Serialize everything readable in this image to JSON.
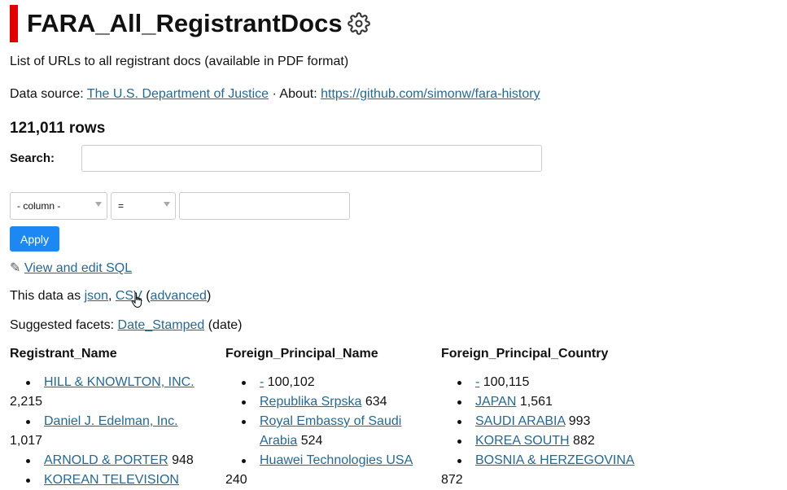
{
  "page": {
    "title": "FARA_All_RegistrantDocs",
    "description": "List of URLs to all registrant docs (available in PDF format)",
    "source_prefix": "Data source: ",
    "source_link": "The U.S. Department of Justice",
    "about_prefix": " · About: ",
    "about_link": "https://github.com/simonw/fara-history",
    "rows_count": "121,011 rows"
  },
  "search": {
    "label": "Search:",
    "value": ""
  },
  "filter": {
    "column_select": "- column -",
    "operator_select": "=",
    "value": "",
    "apply_label": "Apply"
  },
  "sql_link": {
    "icon": "✎",
    "label": "View and edit SQL"
  },
  "export": {
    "prefix": "This data as ",
    "json": "json",
    "sep": ", ",
    "csv": "CSV",
    "open_paren": " (",
    "advanced": "advanced",
    "close_paren": ")"
  },
  "suggested_facets": {
    "prefix": "Suggested facets: ",
    "link": "Date_Stamped",
    "suffix": " (date)"
  },
  "facets": [
    {
      "title": "Registrant_Name",
      "items": [
        {
          "label": "HILL & KNOWLTON, INC.",
          "count": "2,215"
        },
        {
          "label": "Daniel J. Edelman, Inc.",
          "count": "1,017"
        },
        {
          "label": "ARNOLD & PORTER",
          "count": "948"
        },
        {
          "label": "KOREAN TELEVISION",
          "count": ""
        }
      ]
    },
    {
      "title": "Foreign_Principal_Name",
      "items": [
        {
          "label": "-",
          "count": "100,102"
        },
        {
          "label": "Republika Srpska",
          "count": "634"
        },
        {
          "label": "Royal Embassy of Saudi Arabia",
          "count": "524"
        },
        {
          "label": "Huawei Technologies USA",
          "count": "240"
        }
      ]
    },
    {
      "title": "Foreign_Principal_Country",
      "items": [
        {
          "label": "-",
          "count": "100,115"
        },
        {
          "label": "JAPAN",
          "count": "1,561"
        },
        {
          "label": "SAUDI ARABIA",
          "count": "993"
        },
        {
          "label": "KOREA SOUTH",
          "count": "882"
        },
        {
          "label": "BOSNIA & HERZEGOVINA",
          "count": "872"
        }
      ]
    }
  ]
}
